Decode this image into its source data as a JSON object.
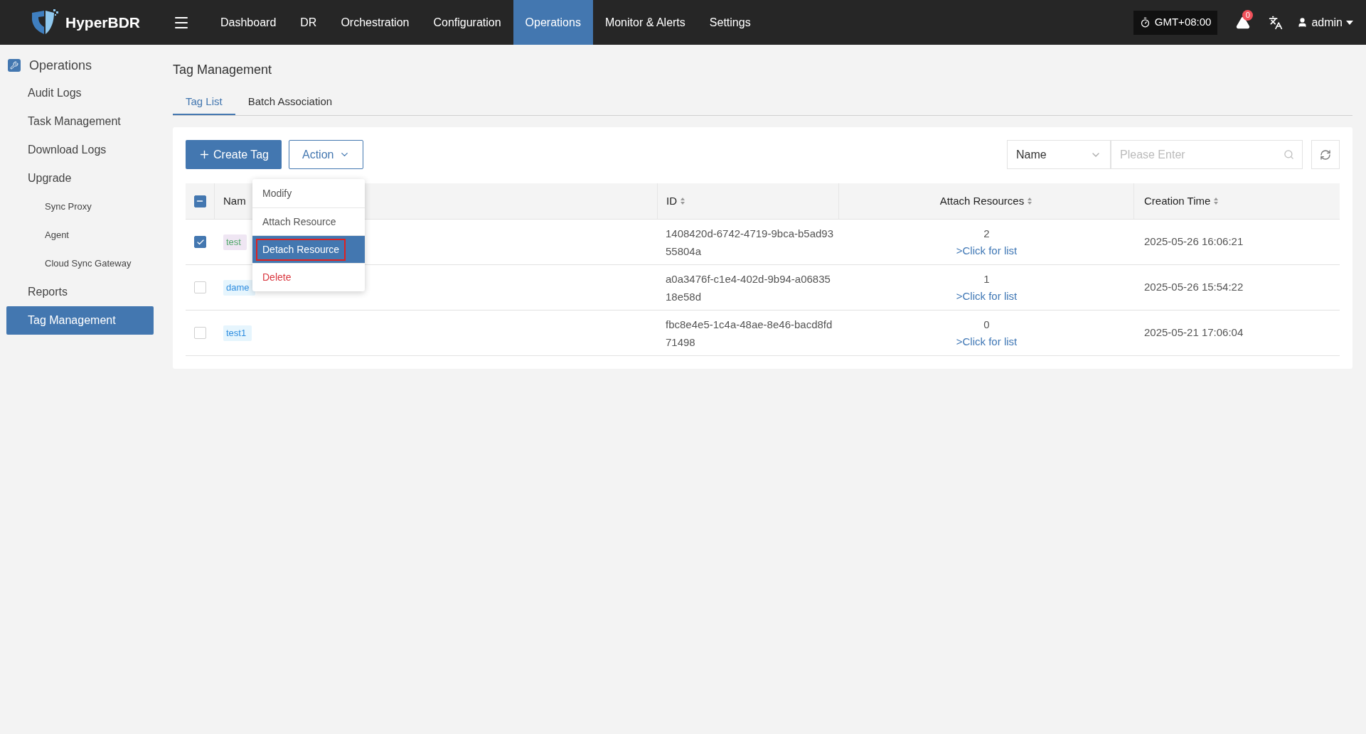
{
  "brand": "HyperBDR",
  "nav": [
    {
      "label": "Dashboard",
      "selected": false
    },
    {
      "label": "DR",
      "selected": false
    },
    {
      "label": "Orchestration",
      "selected": false
    },
    {
      "label": "Configuration",
      "selected": false
    },
    {
      "label": "Operations",
      "selected": true
    },
    {
      "label": "Monitor & Alerts",
      "selected": false
    },
    {
      "label": "Settings",
      "selected": false
    }
  ],
  "timezone": "GMT+08:00",
  "alert_count": "0",
  "user": "admin",
  "sidebar": {
    "title": "Operations",
    "items": [
      {
        "label": "Audit Logs",
        "selected": false
      },
      {
        "label": "Task Management",
        "selected": false
      },
      {
        "label": "Download Logs",
        "selected": false
      },
      {
        "label": "Upgrade",
        "selected": false,
        "children": [
          {
            "label": "Sync Proxy",
            "selected": false
          },
          {
            "label": "Agent",
            "selected": false
          },
          {
            "label": "Cloud Sync Gateway",
            "selected": false
          }
        ]
      },
      {
        "label": "Reports",
        "selected": false
      },
      {
        "label": "Tag Management",
        "selected": true
      }
    ]
  },
  "page_title": "Tag Management",
  "tabs": [
    {
      "label": "Tag List",
      "selected": true
    },
    {
      "label": "Batch Association",
      "selected": false
    }
  ],
  "toolbar": {
    "create_button": "Create Tag",
    "action_button": "Action",
    "filter_select": "Name",
    "search": {
      "placeholder": "Please Enter"
    }
  },
  "action_menu": [
    {
      "label": "Modify",
      "selected": false,
      "kind": "normal"
    },
    {
      "label": "Attach Resource",
      "selected": false,
      "kind": "normal"
    },
    {
      "label": "Detach Resource",
      "selected": true,
      "kind": "normal"
    },
    {
      "label": "Delete",
      "selected": false,
      "kind": "danger"
    }
  ],
  "table": {
    "select_all": {
      "checked": true,
      "partial": true
    },
    "columns": [
      "Nam",
      "ID",
      "Attach Resources",
      "Creation Time"
    ],
    "rows": [
      {
        "checked": true,
        "name": "test",
        "color": "#52a96b",
        "kind": "lilac",
        "id": "1408420d-6742-4719-9bca-b5ad9355804a",
        "count": "2",
        "link": ">Click for list",
        "created": "2025-05-26 16:06:21"
      },
      {
        "checked": false,
        "name": "dame",
        "color": "#2f8ee0",
        "kind": "sky",
        "id": "a0a3476f-c1e4-402d-9b94-a0683518e58d",
        "count": "1",
        "link": ">Click for list",
        "created": "2025-05-26 15:54:22"
      },
      {
        "checked": false,
        "name": "test1",
        "color": "#2f8ee0",
        "kind": "sky",
        "id": "fbc8e4e5-1c4a-48ae-8e46-bacd8fd71498",
        "count": "0",
        "link": ">Click for list",
        "created": "2025-05-21 17:06:04"
      }
    ]
  }
}
